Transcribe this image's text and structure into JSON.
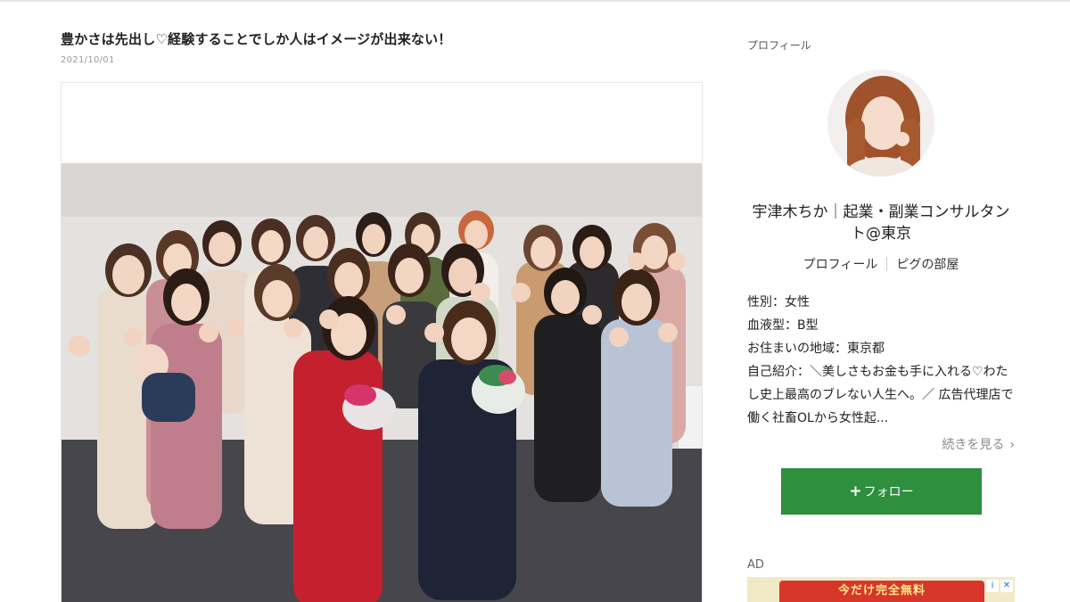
{
  "article": {
    "title": "豊かさは先出し♡経験することでしか人はイメージが出来ない！",
    "date": "2021/10/01"
  },
  "sidebar": {
    "heading": "プロフィール",
    "name": "宇津木ちか｜起業・副業コンサルタント@東京",
    "links": {
      "profile": "プロフィール",
      "room": "ピグの部屋"
    },
    "info": {
      "gender": "性別：女性",
      "blood": "血液型：B型",
      "area": "お住まいの地域：東京都",
      "intro": "自己紹介：＼美しさもお金も手に入れる♡わたし史上最高のブレない人生へ。／ 広告代理店で働く社畜OLから女性起..."
    },
    "more": "続きを見る",
    "follow": "フォロー",
    "ad_label": "AD",
    "ad_text": "今だけ完全無料"
  },
  "colors": {
    "follow_button": "#2e8f3e",
    "ad_banner": "#d8352b"
  },
  "icons": {
    "follow_plus": "plus-icon",
    "more_chevron": "chevron-right-icon",
    "ad_info": "info-icon",
    "ad_close": "close-icon"
  }
}
